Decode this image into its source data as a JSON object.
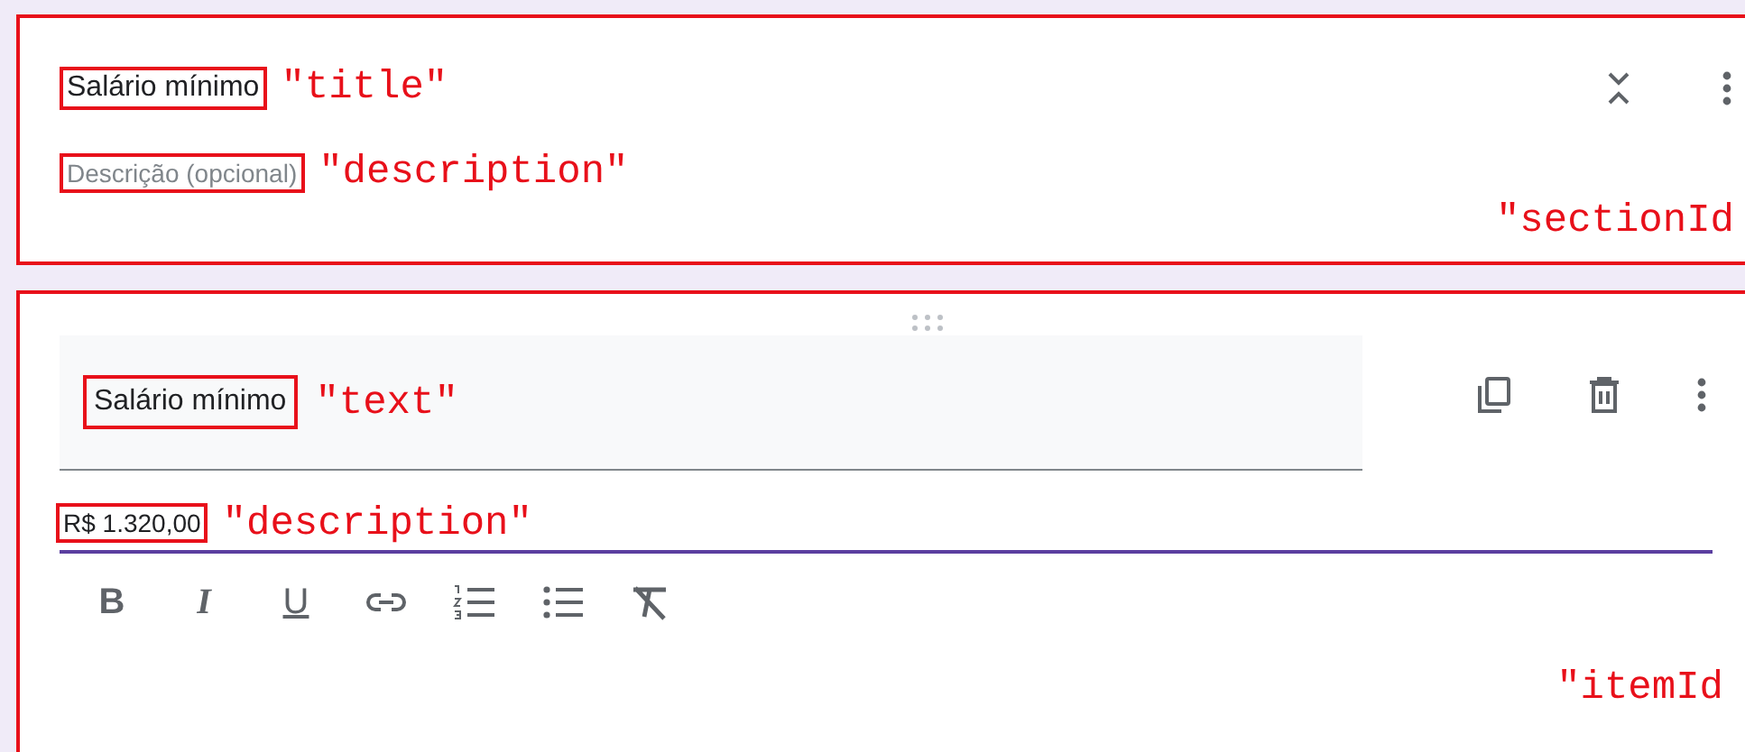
{
  "section": {
    "title": {
      "text": "Salário mínimo",
      "annotation": "\"title\""
    },
    "description": {
      "placeholder": "Descrição (opcional)",
      "annotation": "\"description\""
    },
    "annotation": "\"sectionId"
  },
  "item": {
    "title": {
      "text": "Salário mínimo",
      "annotation": "\"text\""
    },
    "description": {
      "text": "R$ 1.320,00",
      "annotation": "\"description\""
    },
    "toolbar": [
      {
        "kind": "bold",
        "label": "B"
      },
      {
        "kind": "italic",
        "label": "I"
      },
      {
        "kind": "underline",
        "label": "U"
      },
      {
        "kind": "link"
      },
      {
        "kind": "numbered-list"
      },
      {
        "kind": "bulleted-list"
      },
      {
        "kind": "clear-format"
      }
    ],
    "annotation": "\"itemId"
  }
}
